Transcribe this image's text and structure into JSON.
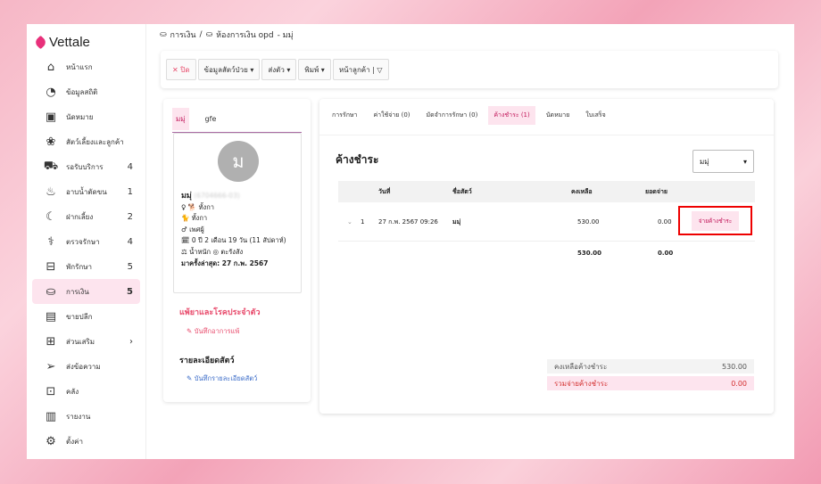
{
  "app": {
    "name": "Vettale"
  },
  "sidebar": {
    "items": [
      {
        "label": "หน้าแรก",
        "icon": "home-icon",
        "count": ""
      },
      {
        "label": "ข้อมูลสถิติ",
        "icon": "stats-icon",
        "count": ""
      },
      {
        "label": "นัดหมาย",
        "icon": "calendar-icon",
        "count": ""
      },
      {
        "label": "สัตว์เลี้ยงและลูกค้า",
        "icon": "paw-icon",
        "count": ""
      },
      {
        "label": "รอรับบริการ",
        "icon": "car-icon",
        "count": "4"
      },
      {
        "label": "อาบน้ำตัดขน",
        "icon": "bath-icon",
        "count": "1"
      },
      {
        "label": "ฝากเลี้ยง",
        "icon": "moon-icon",
        "count": "2"
      },
      {
        "label": "ตรวจรักษา",
        "icon": "stethoscope-icon",
        "count": "4"
      },
      {
        "label": "พักรักษา",
        "icon": "bed-icon",
        "count": "5"
      },
      {
        "label": "การเงิน",
        "icon": "hand-coin-icon",
        "count": "5"
      },
      {
        "label": "ขายปลีก",
        "icon": "cash-register-icon",
        "count": ""
      },
      {
        "label": "ส่วนเสริม",
        "icon": "plus-box-icon",
        "count": "›"
      },
      {
        "label": "ส่งข้อความ",
        "icon": "send-icon",
        "count": ""
      },
      {
        "label": "คลัง",
        "icon": "archive-icon",
        "count": ""
      },
      {
        "label": "รายงาน",
        "icon": "report-icon",
        "count": ""
      },
      {
        "label": "ตั้งค่า",
        "icon": "gear-icon",
        "count": ""
      }
    ]
  },
  "breadcrumb": {
    "part1": "การเงิน",
    "sep": "/",
    "part2": "ห้องการเงิน opd",
    "part3": "- มมุ่"
  },
  "toolbar": {
    "close": "ปิด",
    "pet_info": "ข้อมูลสัตว์ป่วย",
    "refer": "ส่งตัว",
    "print": "พิมพ์",
    "customer_page": "หน้าลูกค้า |"
  },
  "left": {
    "tabs": [
      "มมุ่",
      "gfe"
    ],
    "avatar_letter": "ม",
    "name": "มมุ่",
    "id": "(6704666-03)",
    "lines": [
      "♀ 🐕 ทั้งกา",
      "🐈 ทั้งกา",
      "♂ เพศผู้",
      "🗓 0 ปี 2 เดือน 19 วัน (11 สัปดาห์)",
      "⚖ น้ำหนัก  ◎ ตะรังสัง"
    ],
    "last_visit": "มาครั้งล่าสุด: 27 ก.พ. 2567",
    "allergy_title": "แพ้ยาและโรคประจำตัว",
    "allergy_link": "บันทึกอาการแพ้",
    "details_title": "รายละเอียดสัตว์",
    "details_link": "บันทึกรายละเอียดสัตว์"
  },
  "right": {
    "tabs": [
      "การรักษา",
      "ค่าใช้จ่าย (0)",
      "มัดจำการรักษา (0)",
      "ค้างชำระ (1)",
      "นัดหมาย",
      "ใบเสร็จ"
    ],
    "title": "ค้างชำระ",
    "select_value": "มมุ่",
    "headers": {
      "date": "วันที่",
      "pet": "ชื่อสัตว์",
      "remaining": "คงเหลือ",
      "paid": "ยอดจ่าย"
    },
    "row": {
      "no": "1",
      "date": "27 ก.พ. 2567 09:26",
      "pet": "มมุ่",
      "remaining": "530.00",
      "paid": "0.00",
      "action": "จ่ายค้างชำระ"
    },
    "totals": {
      "remaining": "530.00",
      "paid": "0.00"
    },
    "summary": {
      "remaining_label": "คงเหลือค้างชำระ",
      "remaining_value": "530.00",
      "total_label": "รวมจ่ายค้างชำระ",
      "total_value": "0.00"
    }
  }
}
